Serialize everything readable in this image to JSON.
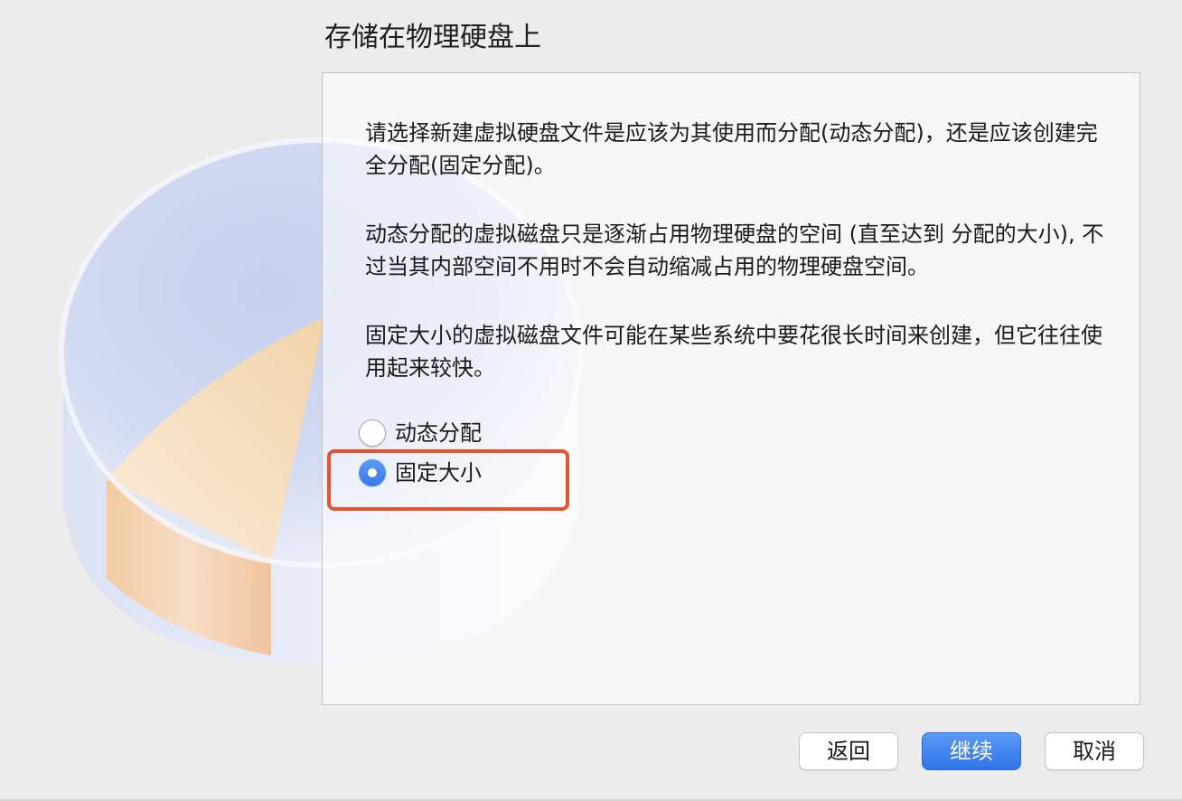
{
  "header": {
    "title": "存储在物理硬盘上"
  },
  "content": {
    "paragraph_1": "请选择新建虚拟硬盘文件是应该为其使用而分配(动态分配)，还是应该创建完全分配(固定分配)。",
    "paragraph_2": "动态分配的虚拟磁盘只是逐渐占用物理硬盘的空间 (直至达到 分配的大小), 不过当其内部空间不用时不会自动缩减占用的物理硬盘空间。",
    "paragraph_3": "固定大小的虚拟磁盘文件可能在某些系统中要花很长时间来创建，但它往往使用起来较快。"
  },
  "options": [
    {
      "label": "动态分配",
      "selected": false
    },
    {
      "label": "固定大小",
      "selected": true
    }
  ],
  "buttons": {
    "back": "返回",
    "continue": "继续",
    "cancel": "取消"
  },
  "colors": {
    "accent": "#3478e8",
    "highlight": "#e8522e"
  },
  "icons": {
    "illustration": "disk-pie-icon"
  }
}
